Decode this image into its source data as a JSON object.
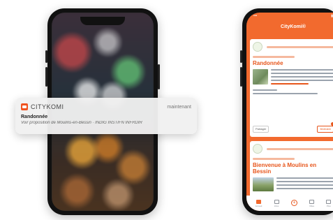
{
  "notification": {
    "app_name": "CITYKOMI",
    "time": "maintenant",
    "title": "Randonnée",
    "body": "Voir proposition de Moulins-en-Bessin · INDIG INSTIFN INFRDIR"
  },
  "right_phone": {
    "header_title": "CityKomi®",
    "cards": [
      {
        "title": "Randonnée",
        "footer_left": "Partager",
        "footer_right": "Itinéraire"
      },
      {
        "title": "Bienvenue à Moulins en Bessin"
      }
    ],
    "tabs": [
      {
        "label": "Accueil"
      },
      {
        "label": "Infos"
      },
      {
        "label": ""
      },
      {
        "label": "Villes"
      },
      {
        "label": "Plus"
      }
    ]
  },
  "colors": {
    "brand_orange": "#f26a2e",
    "accent_red": "#e7561c"
  }
}
